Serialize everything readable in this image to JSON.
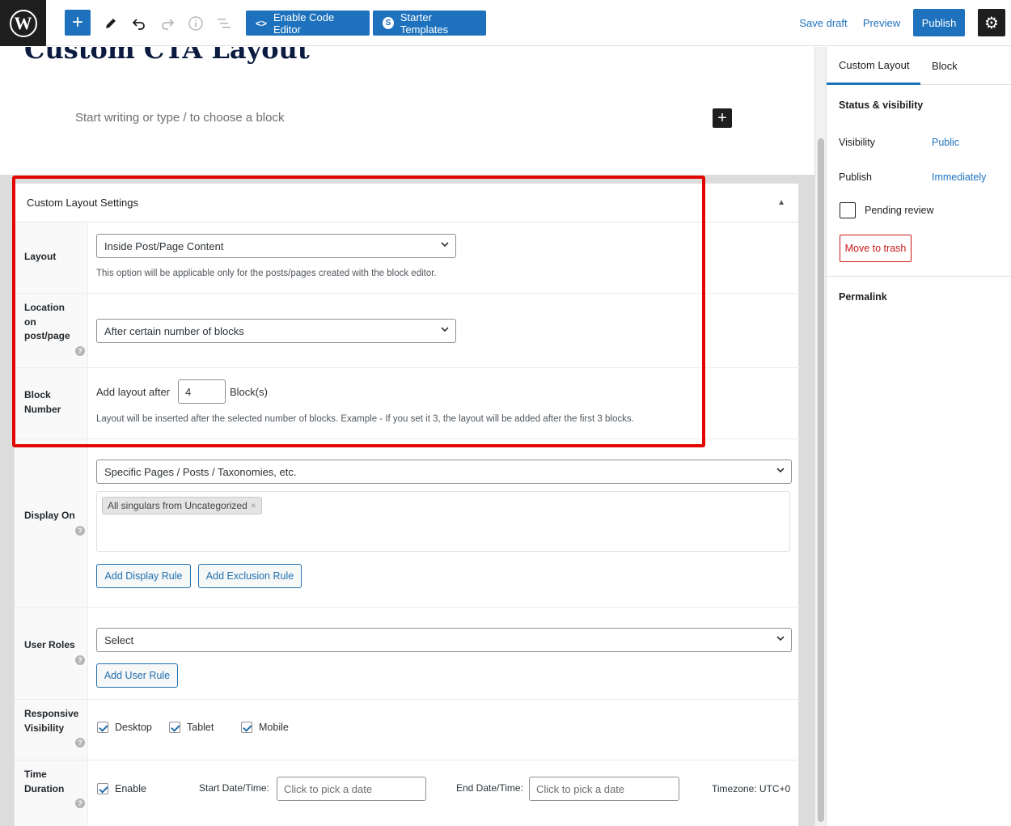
{
  "toolbar": {
    "enable_code_editor": "Enable Code Editor",
    "starter_templates": "Starter Templates",
    "save_draft": "Save draft",
    "preview": "Preview",
    "publish": "Publish"
  },
  "editor": {
    "post_title": "Custom CTA Layout",
    "placeholder": "Start writing or type / to choose a block"
  },
  "metabox": {
    "title": "Custom Layout Settings",
    "layout": {
      "label": "Layout",
      "value": "Inside Post/Page Content",
      "note": "This option will be applicable only for the posts/pages created with the block editor."
    },
    "location": {
      "label_lines": [
        "Location",
        "on",
        "post/page"
      ],
      "value": "After certain number of blocks"
    },
    "block_number": {
      "label_lines": [
        "Block",
        "Number"
      ],
      "prefix": "Add layout after",
      "value": "4",
      "suffix": "Block(s)",
      "note": "Layout will be inserted after the selected number of blocks. Example - If you set it 3, the layout will be added after the first 3 blocks."
    },
    "display_on": {
      "label": "Display On",
      "value": "Specific Pages / Posts / Taxonomies, etc.",
      "tag": "All singulars from Uncategorized",
      "add_display_rule": "Add Display Rule",
      "add_exclusion_rule": "Add Exclusion Rule"
    },
    "user_roles": {
      "label": "User Roles",
      "value": "Select",
      "add_user_rule": "Add User Rule"
    },
    "responsive": {
      "label_lines": [
        "Responsive",
        "Visibility"
      ],
      "desktop": "Desktop",
      "tablet": "Tablet",
      "mobile": "Mobile"
    },
    "time_duration": {
      "label_lines": [
        "Time",
        "Duration"
      ],
      "enable": "Enable",
      "start_label": "Start Date/Time:",
      "start_placeholder": "Click to pick a date",
      "end_label": "End Date/Time:",
      "end_placeholder": "Click to pick a date",
      "timezone": "Timezone: UTC+0"
    }
  },
  "sidebar": {
    "tabs": [
      "Custom Layout",
      "Block"
    ],
    "status_title": "Status & visibility",
    "visibility_label": "Visibility",
    "visibility_value": "Public",
    "publish_label": "Publish",
    "publish_value": "Immediately",
    "pending_review": "Pending review",
    "move_to_trash": "Move to trash",
    "permalink": "Permalink"
  },
  "colors": {
    "accent": "#1e72bd",
    "highlight_frame": "#e10600",
    "dark": "#1e1e1e"
  }
}
